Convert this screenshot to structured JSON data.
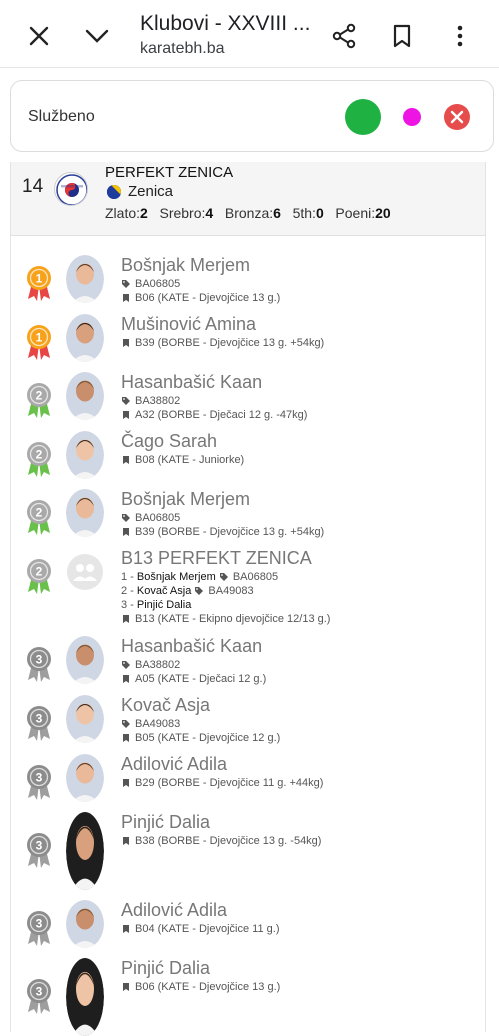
{
  "topbar": {
    "title": "Klubovi - XXVIII ...",
    "url": "karatebh.ba"
  },
  "filter": {
    "label": "Službeno"
  },
  "club": {
    "rank": "14",
    "name": "PERFEKT ZENICA",
    "city": "Zenica",
    "stats": {
      "gold_label": "Zlato:",
      "gold": "2",
      "silver_label": "Srebro:",
      "silver": "4",
      "bronze_label": "Bronza:",
      "bronze": "6",
      "fifth_label": "5th:",
      "fifth": "0",
      "points_label": "Poeni:",
      "points": "20"
    }
  },
  "entries": [
    {
      "medal": "1",
      "name": "Bošnjak Merjem",
      "id": "BA06805",
      "category": "B06 (KATE - Djevojčice 13 g.)"
    },
    {
      "medal": "1",
      "name": "Mušinović Amina",
      "category": "B39 (BORBE - Djevojčice 13 g. +54kg)"
    },
    {
      "medal": "2",
      "name": "Hasanbašić Kaan",
      "id": "BA38802",
      "category": "A32 (BORBE - Dječaci 12 g. -47kg)"
    },
    {
      "medal": "2",
      "name": "Čago Sarah",
      "category": "B08 (KATE - Juniorke)"
    },
    {
      "medal": "2",
      "name": "Bošnjak Merjem",
      "id": "BA06805",
      "category": "B39 (BORBE - Djevojčice 13 g. +54kg)"
    },
    {
      "medal": "2",
      "name": "B13 PERFEKT ZENICA",
      "members": [
        {
          "num": "1 -",
          "name": "Bošnjak Merjem",
          "id": "BA06805"
        },
        {
          "num": "2 -",
          "name": "Kovač Asja",
          "id": "BA49083"
        },
        {
          "num": "3 -",
          "name": "Pinjić Dalia"
        }
      ],
      "category": "B13 (KATE - Ekipno djevojčice 12/13 g.)"
    },
    {
      "medal": "3",
      "name": "Hasanbašić Kaan",
      "id": "BA38802",
      "category": "A05 (KATE - Dječaci 12 g.)"
    },
    {
      "medal": "3",
      "name": "Kovač Asja",
      "id": "BA49083",
      "category": "B05 (KATE - Djevojčice 12 g.)"
    },
    {
      "medal": "3",
      "name": "Adilović Adila",
      "category": "B29 (BORBE - Djevojčice 11 g. +44kg)"
    },
    {
      "medal": "3",
      "name": "Pinjić Dalia",
      "category": "B38 (BORBE - Djevojčice 13 g. -54kg)"
    },
    {
      "medal": "3",
      "name": "Adilović Adila",
      "category": "B04 (KATE - Djevojčice 11 g.)"
    },
    {
      "medal": "3",
      "name": "Pinjić Dalia",
      "category": "B06 (KATE - Djevojčice 13 g.)"
    }
  ],
  "colors": {
    "gold": "#f7a21b",
    "silver": "#a9a9a9",
    "bronze": "#8c8c8c",
    "ribbon_red": "#e84545",
    "ribbon_green": "#69c04a",
    "ribbon_grey": "#9e9e9e",
    "accent_green": "#1fb141",
    "accent_magenta": "#ee14e3",
    "accent_red": "#e74c4c"
  }
}
